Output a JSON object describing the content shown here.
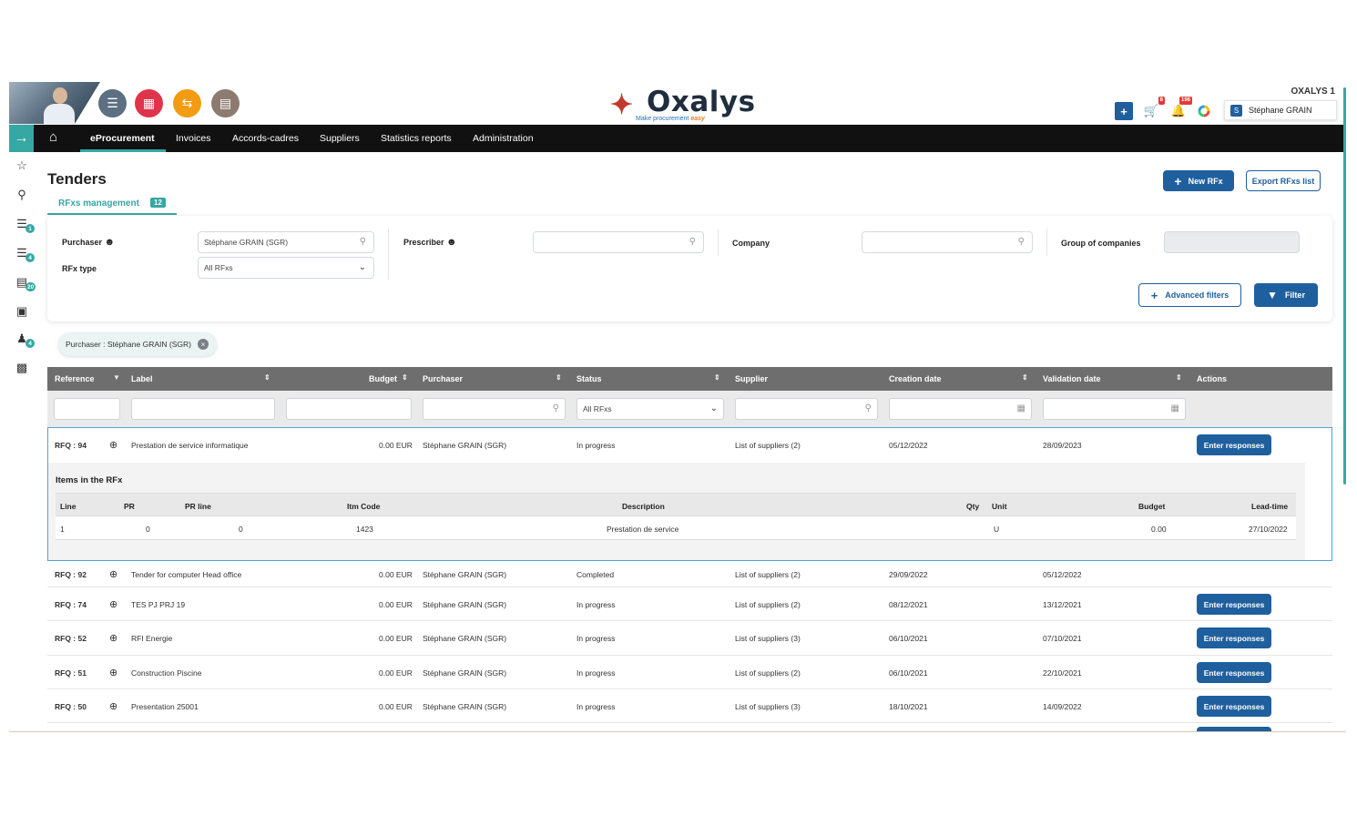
{
  "header": {
    "company": "OXALYS 1",
    "logo_word": "Oxalys",
    "logo_tagline": "Make procurement",
    "logo_tagline_em": "easy",
    "cart_badge": "8",
    "bell_badge": "198",
    "user_initial": "S",
    "user_name": "Stéphane GRAIN"
  },
  "nav": {
    "items": [
      "eProcurement",
      "Invoices",
      "Accords-cadres",
      "Suppliers",
      "Statistics reports",
      "Administration"
    ],
    "active": "eProcurement"
  },
  "rail": {
    "badges": [
      "1",
      "4",
      "20",
      "4"
    ]
  },
  "page": {
    "title": "Tenders",
    "subtab_label": "RFxs management",
    "subtab_count": "12",
    "new_button": "New RFx",
    "export_button": "Export RFxs list"
  },
  "filters": {
    "purchaser_label": "Purchaser",
    "purchaser_value": "Stéphane GRAIN (SGR)",
    "rfx_type_label": "RFx type",
    "rfx_type_value": "All RFxs",
    "prescriber_label": "Prescriber",
    "company_label": "Company",
    "group_label": "Group of companies",
    "advanced_button": "Advanced filters",
    "filter_button": "Filter",
    "chip_text": "Purchaser : Stéphane GRAIN (SGR)"
  },
  "table": {
    "columns": [
      "Reference",
      "Label",
      "Budget",
      "Purchaser",
      "Status",
      "Supplier",
      "Creation date",
      "Validation date",
      "Actions"
    ],
    "status_filter_value": "All RFxs",
    "action_label": "Enter responses",
    "rows": [
      {
        "ref": "RFQ : 94",
        "label": "Prestation de service informatique",
        "budget": "0.00 EUR",
        "purchaser": "Stéphane GRAIN (SGR)",
        "status": "In progress",
        "supplier": "List of suppliers (2)",
        "created": "05/12/2022",
        "validated": "28/09/2023",
        "action": true
      },
      {
        "ref": "RFQ : 92",
        "label": "Tender for computer Head office",
        "budget": "0.00 EUR",
        "purchaser": "Stéphane GRAIN (SGR)",
        "status": "Completed",
        "supplier": "List of suppliers (2)",
        "created": "29/09/2022",
        "validated": "05/12/2022",
        "action": false
      },
      {
        "ref": "RFQ : 74",
        "label": "TES PJ PRJ 19",
        "budget": "0.00 EUR",
        "purchaser": "Stéphane GRAIN (SGR)",
        "status": "In progress",
        "supplier": "List of suppliers (2)",
        "created": "08/12/2021",
        "validated": "13/12/2021",
        "action": true
      },
      {
        "ref": "RFQ : 52",
        "label": "RFI Energie",
        "budget": "0.00 EUR",
        "purchaser": "Stéphane GRAIN (SGR)",
        "status": "In progress",
        "supplier": "List of suppliers (3)",
        "created": "06/10/2021",
        "validated": "07/10/2021",
        "action": true
      },
      {
        "ref": "RFQ : 51",
        "label": "Construction Piscine",
        "budget": "0.00 EUR",
        "purchaser": "Stéphane GRAIN (SGR)",
        "status": "In progress",
        "supplier": "List of suppliers (2)",
        "created": "06/10/2021",
        "validated": "22/10/2021",
        "action": true
      },
      {
        "ref": "RFQ : 50",
        "label": "Presentation 25001",
        "budget": "0.00 EUR",
        "purchaser": "Stéphane GRAIN (SGR)",
        "status": "In progress",
        "supplier": "List of suppliers (3)",
        "created": "18/10/2021",
        "validated": "14/09/2022",
        "action": true
      }
    ]
  },
  "items": {
    "title": "Items in the RFx",
    "columns": [
      "Line",
      "PR",
      "PR line",
      "Itm Code",
      "Description",
      "Qty",
      "Unit",
      "Budget",
      "Lead-time"
    ],
    "row": {
      "line": "1",
      "pr": "0",
      "pr_line": "0",
      "itm_code": "1423",
      "description": "Prestation de service",
      "qty": "",
      "unit": "U",
      "budget": "0.00",
      "lead_time": "27/10/2022"
    }
  },
  "colors": {
    "accent": "#35a8a4",
    "primary": "#1f5f9e",
    "navbar": "#111111",
    "table_header": "#6e6e6e"
  }
}
